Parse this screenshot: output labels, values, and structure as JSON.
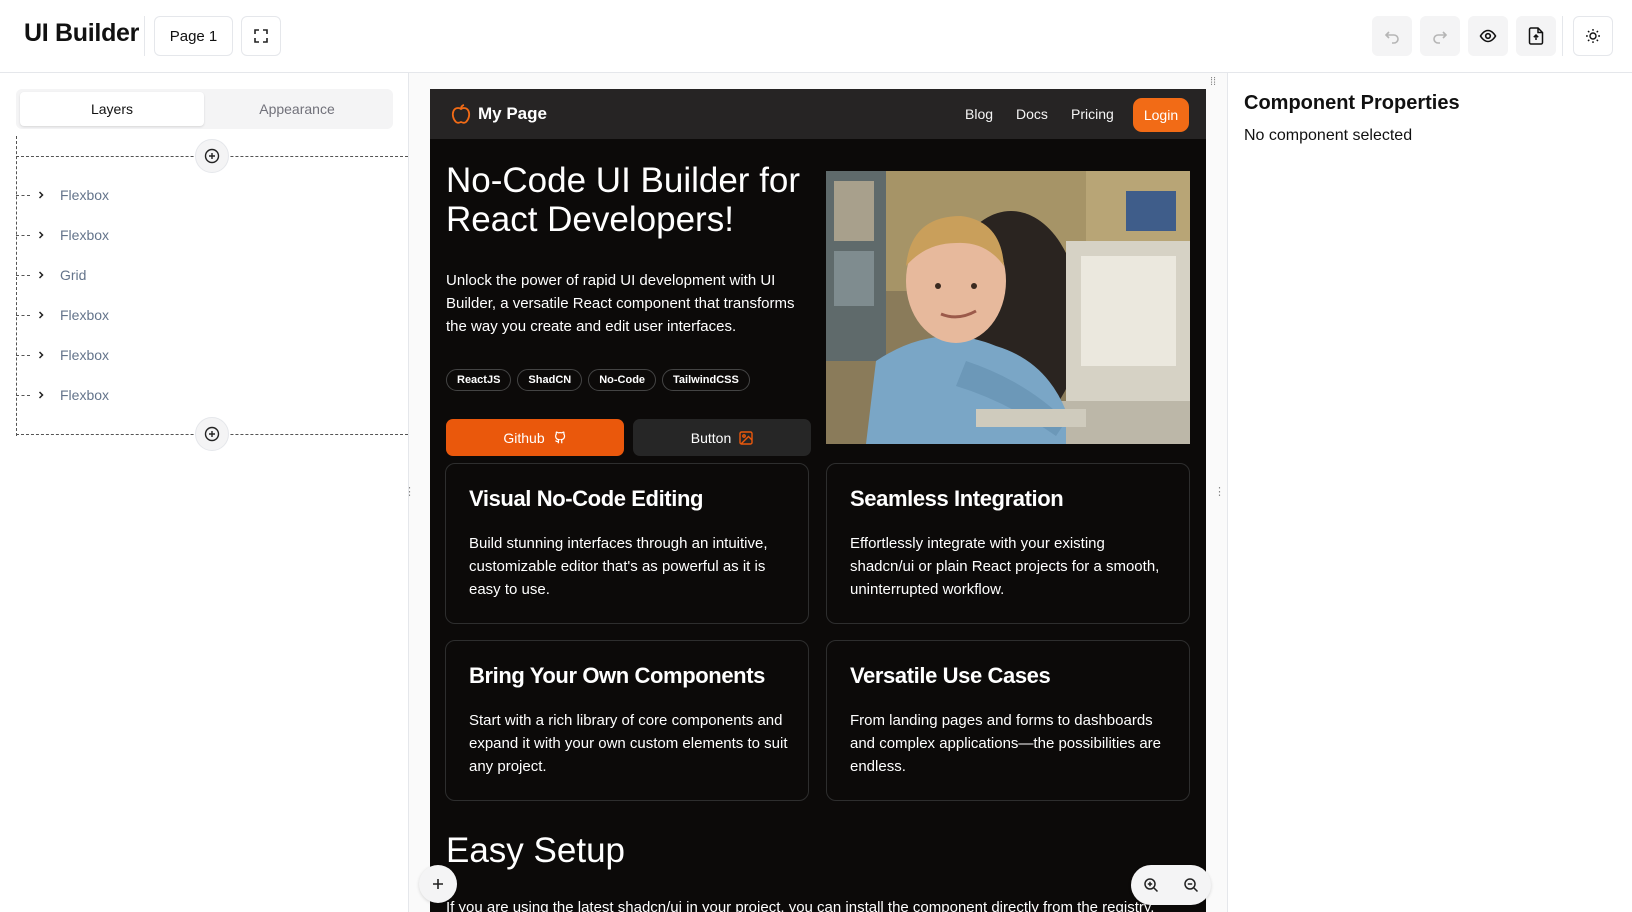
{
  "app": {
    "title": "UI Builder",
    "page_select": "Page 1"
  },
  "toolbar": {
    "undo_icon": "undo-icon",
    "redo_icon": "redo-icon",
    "preview_icon": "eye-icon",
    "export_icon": "file-export-icon",
    "theme_icon": "sun-icon"
  },
  "left_panel": {
    "tabs": [
      {
        "label": "Layers",
        "active": true
      },
      {
        "label": "Appearance",
        "active": false
      }
    ],
    "layers": [
      {
        "label": "Flexbox"
      },
      {
        "label": "Flexbox"
      },
      {
        "label": "Grid"
      },
      {
        "label": "Flexbox"
      },
      {
        "label": "Flexbox"
      },
      {
        "label": "Flexbox"
      }
    ]
  },
  "preview": {
    "brand": "My Page",
    "nav_links": [
      "Blog",
      "Docs",
      "Pricing"
    ],
    "login_label": "Login",
    "hero_title": "No-Code UI Builder for React Developers!",
    "hero_text": "Unlock the power of rapid UI development with UI Builder, a versatile React component that transforms the way you create and edit user interfaces.",
    "chips": [
      "ReactJS",
      "ShadCN",
      "No-Code",
      "TailwindCSS"
    ],
    "github_label": "Github",
    "button_label": "Button",
    "cards": [
      {
        "title": "Visual No-Code Editing",
        "text": "Build stunning interfaces through an intuitive, customizable editor that's as powerful as it is easy to use."
      },
      {
        "title": "Seamless Integration",
        "text": "Effortlessly integrate with your existing shadcn/ui or plain React projects for a smooth, uninterrupted workflow."
      },
      {
        "title": "Bring Your Own Components",
        "text": "Start with a rich library of core components and expand it with your own custom elements to suit any project."
      },
      {
        "title": "Versatile Use Cases",
        "text": "From landing pages and forms to dashboards and complex applications—the possibilities are endless."
      }
    ],
    "setup_title": "Easy Setup",
    "setup_text": "If you are using the latest shadcn/ui in your project, you can install the component directly from the registry."
  },
  "right_panel": {
    "title": "Component Properties",
    "empty": "No component selected"
  },
  "colors": {
    "accent": "#ea580c",
    "preview_bg": "#0c0a09"
  }
}
